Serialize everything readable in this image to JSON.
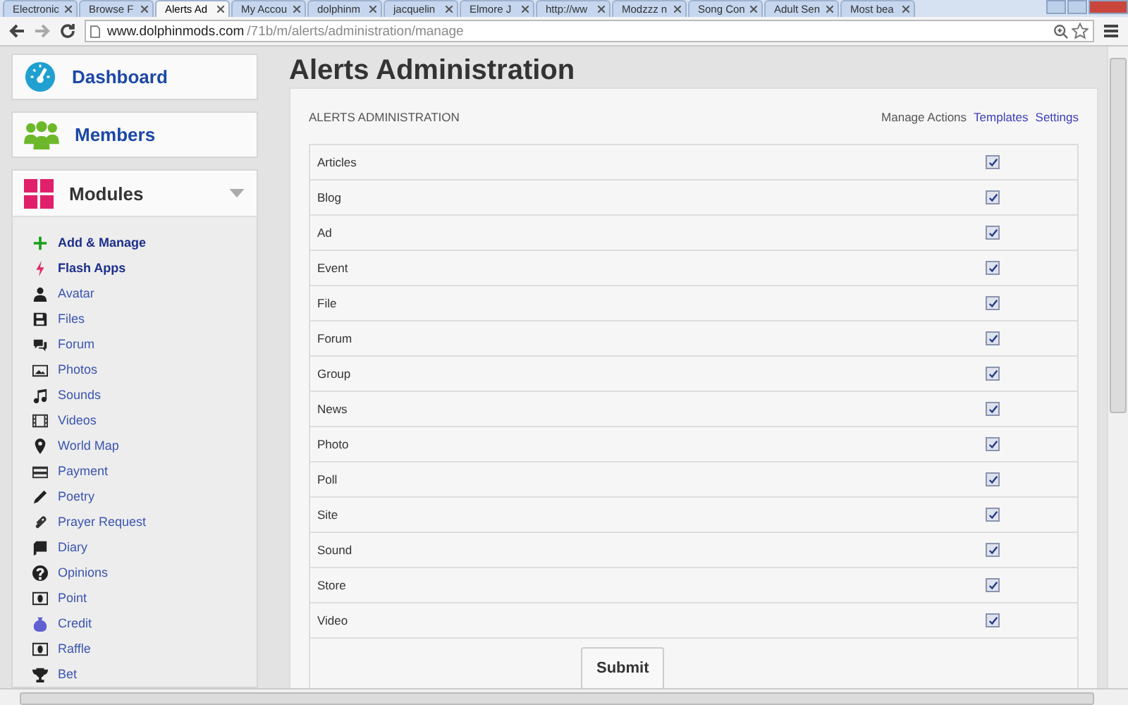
{
  "browser": {
    "tabs": [
      {
        "title": "Electronic",
        "selected": false
      },
      {
        "title": "Browse F",
        "selected": false
      },
      {
        "title": "Alerts Ad",
        "selected": true
      },
      {
        "title": "My Accou",
        "selected": false
      },
      {
        "title": "dolphinm",
        "selected": false
      },
      {
        "title": "jacquelin",
        "selected": false
      },
      {
        "title": "Elmore J",
        "selected": false
      },
      {
        "title": "http://ww",
        "selected": false
      },
      {
        "title": "Modzzz n",
        "selected": false
      },
      {
        "title": "Song Con",
        "selected": false
      },
      {
        "title": "Adult Sen",
        "selected": false
      },
      {
        "title": "Most bea",
        "selected": false
      }
    ],
    "url_host": "www.dolphinmods.com",
    "url_path": "/71b/m/alerts/administration/manage"
  },
  "sidebar": {
    "sections": [
      {
        "label": "Dashboard"
      },
      {
        "label": "Members"
      },
      {
        "label": "Modules",
        "expanded": true
      }
    ],
    "items": [
      {
        "label": "Add & Manage",
        "emphasized": true
      },
      {
        "label": "Flash Apps",
        "emphasized": true
      },
      {
        "label": "Avatar",
        "emphasized": false
      },
      {
        "label": "Files",
        "emphasized": false
      },
      {
        "label": "Forum",
        "emphasized": false
      },
      {
        "label": "Photos",
        "emphasized": false
      },
      {
        "label": "Sounds",
        "emphasized": false
      },
      {
        "label": "Videos",
        "emphasized": false
      },
      {
        "label": "World Map",
        "emphasized": false
      },
      {
        "label": "Payment",
        "emphasized": false
      },
      {
        "label": "Poetry",
        "emphasized": false
      },
      {
        "label": "Prayer Request",
        "emphasized": false
      },
      {
        "label": "Diary",
        "emphasized": false
      },
      {
        "label": "Opinions",
        "emphasized": false
      },
      {
        "label": "Point",
        "emphasized": false
      },
      {
        "label": "Credit",
        "emphasized": false
      },
      {
        "label": "Raffle",
        "emphasized": false
      },
      {
        "label": "Bet",
        "emphasized": false
      }
    ]
  },
  "page_title": "Alerts Administration",
  "panel": {
    "title": "ALERTS ADMINISTRATION",
    "links": [
      {
        "label": "Manage Actions",
        "selected": true
      },
      {
        "label": "Templates",
        "selected": false
      },
      {
        "label": "Settings",
        "selected": false
      }
    ],
    "rows": [
      {
        "label": "Articles",
        "checked": true
      },
      {
        "label": "Blog",
        "checked": true
      },
      {
        "label": "Ad",
        "checked": true
      },
      {
        "label": "Event",
        "checked": true
      },
      {
        "label": "File",
        "checked": true
      },
      {
        "label": "Forum",
        "checked": true
      },
      {
        "label": "Group",
        "checked": true
      },
      {
        "label": "News",
        "checked": true
      },
      {
        "label": "Photo",
        "checked": true
      },
      {
        "label": "Poll",
        "checked": true
      },
      {
        "label": "Site",
        "checked": true
      },
      {
        "label": "Sound",
        "checked": true
      },
      {
        "label": "Store",
        "checked": true
      },
      {
        "label": "Video",
        "checked": true
      }
    ],
    "submit": "Submit"
  }
}
